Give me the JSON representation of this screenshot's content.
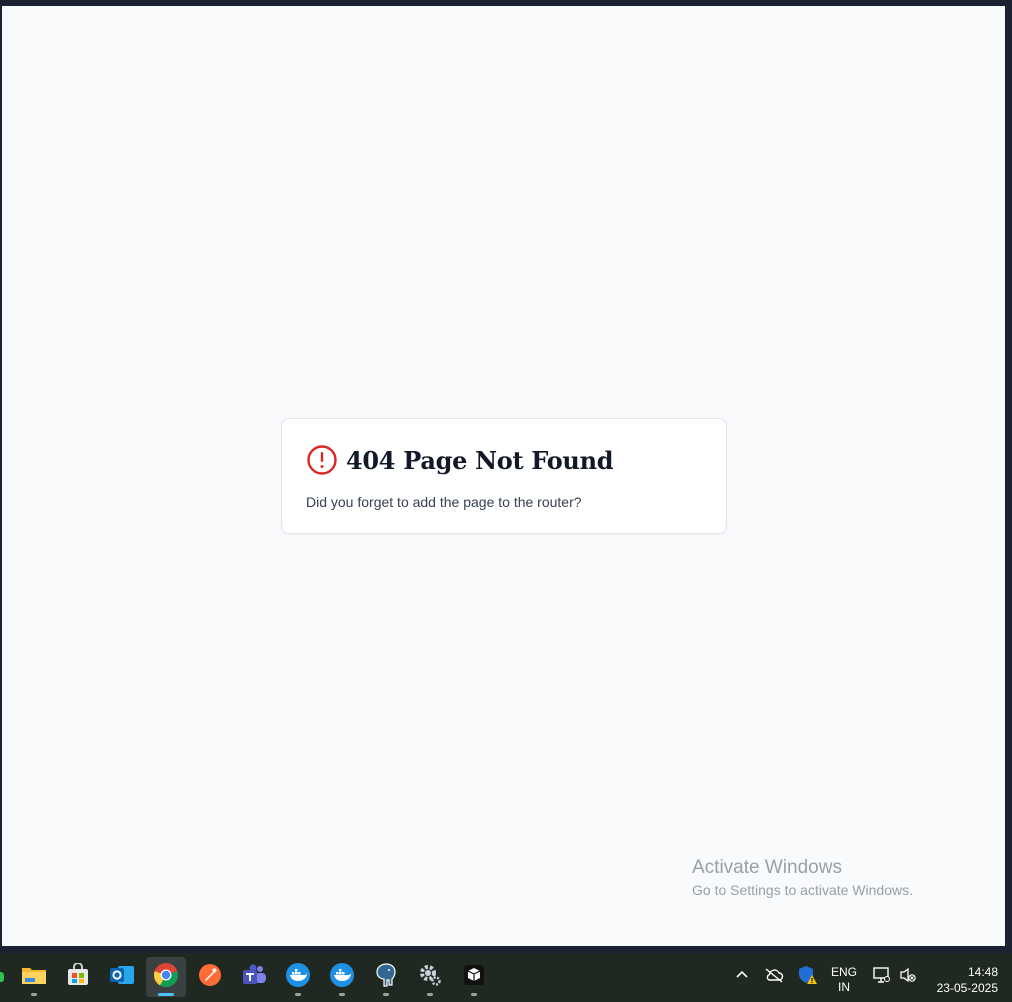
{
  "page": {
    "error_title": "404 Page Not Found",
    "error_message": "Did you forget to add the page to the router?",
    "icon": "alert-circle-icon",
    "icon_color": "#dc2626",
    "background_color": "#f8fafc"
  },
  "watermark": {
    "title": "Activate Windows",
    "subtitle": "Go to Settings to activate Windows."
  },
  "taskbar": {
    "apps": [
      {
        "name": "file-explorer",
        "icon": "folder-icon"
      },
      {
        "name": "microsoft-store",
        "icon": "store-icon"
      },
      {
        "name": "outlook",
        "icon": "outlook-icon"
      },
      {
        "name": "chrome",
        "icon": "chrome-icon",
        "active": true
      },
      {
        "name": "postman",
        "icon": "postman-icon"
      },
      {
        "name": "teams",
        "icon": "teams-icon"
      },
      {
        "name": "docker",
        "icon": "docker-icon"
      },
      {
        "name": "docker-2",
        "icon": "docker-icon"
      },
      {
        "name": "pgadmin",
        "icon": "elephant-icon"
      },
      {
        "name": "settings",
        "icon": "gear-icon"
      },
      {
        "name": "terminal-app",
        "icon": "box-icon"
      }
    ],
    "tray": {
      "language_line1": "ENG",
      "language_line2": "IN",
      "time": "14:48",
      "date": "23-05-2025"
    }
  }
}
